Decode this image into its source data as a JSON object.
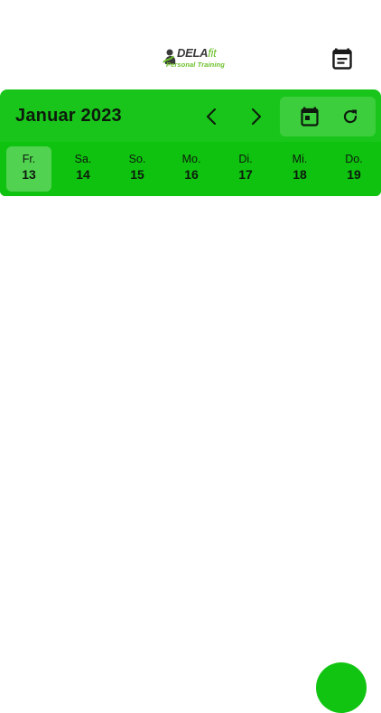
{
  "header": {
    "logo": {
      "brand_part1": "DELA",
      "brand_part2": "fit",
      "subtitle": "Personal Training"
    },
    "calendar_icon": "calendar-note-icon"
  },
  "calendar": {
    "month_label": "Januar 2023",
    "prev_icon": "chevron-left-icon",
    "next_icon": "chevron-right-icon",
    "today_icon": "calendar-today-icon",
    "refresh_icon": "refresh-icon",
    "days": [
      {
        "name": "Fr.",
        "date": "13",
        "selected": true
      },
      {
        "name": "Sa.",
        "date": "14",
        "selected": false
      },
      {
        "name": "So.",
        "date": "15",
        "selected": false
      },
      {
        "name": "Mo.",
        "date": "16",
        "selected": false
      },
      {
        "name": "Di.",
        "date": "17",
        "selected": false
      },
      {
        "name": "Mi.",
        "date": "18",
        "selected": false
      },
      {
        "name": "Do.",
        "date": "19",
        "selected": false
      }
    ]
  },
  "colors": {
    "accent": "#19c51a",
    "strip": "#0fc20f",
    "text": "#0d1a0d"
  }
}
